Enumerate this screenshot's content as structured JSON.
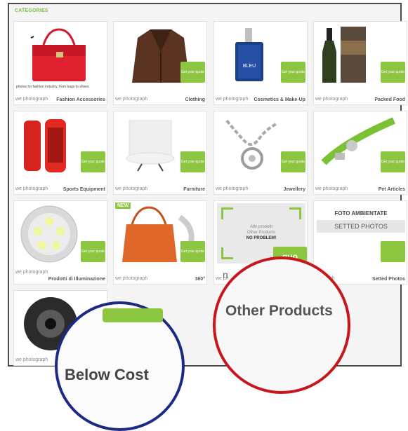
{
  "header": {
    "title": "CATEGORIES"
  },
  "tiles": [
    {
      "caption": "photos for fashion industry, from bags to shoes",
      "photographer": "we photograph",
      "name": "Fashion Accessories",
      "quote": ""
    },
    {
      "photographer": "we photograph",
      "name": "Clothing",
      "quote": "Get your quote"
    },
    {
      "photographer": "we photograph",
      "name": "Cosmetics & Make-Up",
      "quote": "Get your quote",
      "product_label": "BLEU"
    },
    {
      "photographer": "we photograph",
      "name": "Packed Food",
      "quote": "Get your quote"
    },
    {
      "photographer": "we photograph",
      "name": "Sports Equipment",
      "quote": "Get your quote"
    },
    {
      "photographer": "we photograph",
      "name": "Furniture",
      "quote": "Get your quote"
    },
    {
      "photographer": "we photograph",
      "name": "Jewellery",
      "quote": "Get your quote"
    },
    {
      "photographer": "we photograph",
      "name": "Pet Articles",
      "quote": "Get your quote"
    },
    {
      "photographer": "we photograph",
      "name": "Prodotti di Illuminazione",
      "quote": "Get your quote"
    },
    {
      "photographer": "we photograph",
      "name": "360°",
      "quote": "Get your quote",
      "badge": "NEW"
    },
    {
      "photographer": "we ph",
      "name": "",
      "quote": "quo",
      "other_lines": [
        "Altri prodotti",
        "Other Products",
        "NO PROBLEM!"
      ]
    },
    {
      "photographer": "otograph",
      "name": "Setted Photos",
      "quote": "",
      "foto_line1": "FOTO AMBIENTATE",
      "foto_line2": "SETTED PHOTOS"
    },
    {
      "photographer": "we photograph",
      "name": "",
      "quote": ""
    }
  ],
  "zoom": {
    "red": {
      "text": "Other Products",
      "small": "n"
    },
    "blue": {
      "text": "Below Cost"
    }
  },
  "colors": {
    "accent_green": "#8cc53f",
    "red_circle": "#c8161d",
    "blue_circle": "#1c2a86"
  }
}
